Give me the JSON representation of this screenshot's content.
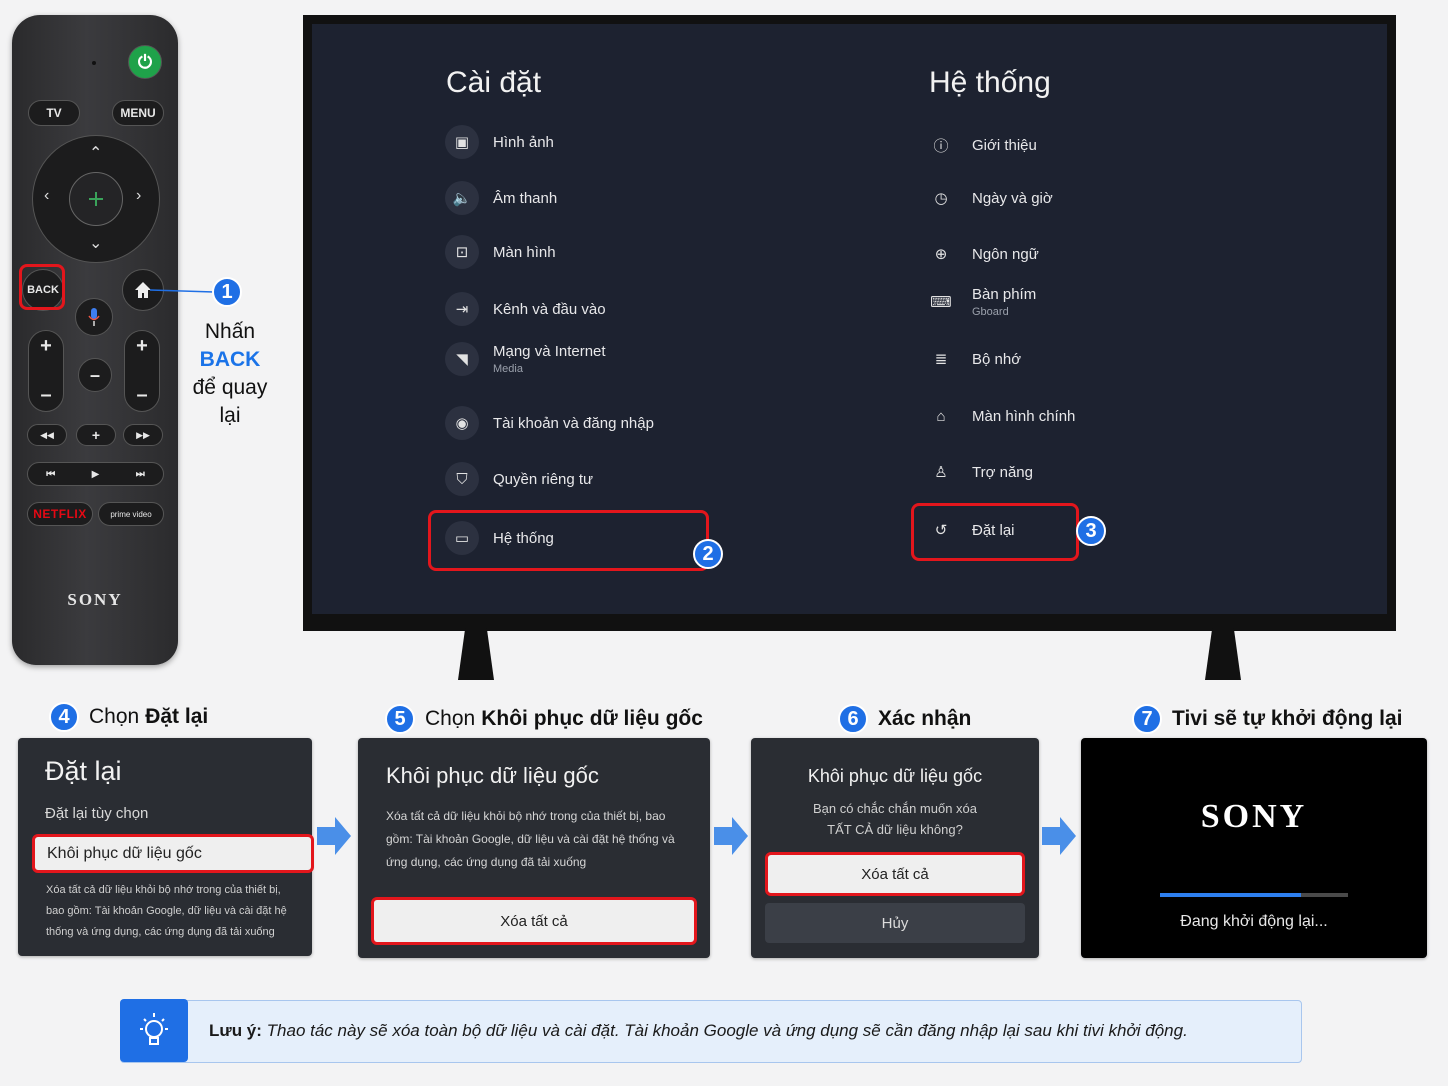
{
  "remote": {
    "tv_label": "TV",
    "menu_label": "MENU",
    "back_label": "BACK",
    "netflix_label": "NETFLIX",
    "prime_label": "prime video",
    "brand": "SONY"
  },
  "step1": {
    "number": "1",
    "line1": "Nhấn",
    "line2": "BACK",
    "line3": "để quay lại"
  },
  "tv": {
    "left_title": "Cài đặt",
    "right_title": "Hệ thống",
    "left_items": [
      {
        "label": "Hình ảnh",
        "icon": "image-icon"
      },
      {
        "label": "Âm thanh",
        "icon": "speaker-icon"
      },
      {
        "label": "Màn hình",
        "icon": "screen-icon"
      },
      {
        "label": "Kênh và đầu vào",
        "icon": "input-icon"
      },
      {
        "label": "Mạng và Internet",
        "sub": "Media",
        "icon": "wifi-icon"
      },
      {
        "label": "Tài khoản và đăng nhập",
        "icon": "account-icon"
      },
      {
        "label": "Quyền riêng tư",
        "icon": "shield-icon"
      },
      {
        "label": "Hệ thống",
        "icon": "monitor-icon"
      }
    ],
    "right_items": [
      {
        "label": "Giới thiệu",
        "icon": "info-icon"
      },
      {
        "label": "Ngày và giờ",
        "icon": "clock-icon"
      },
      {
        "label": "Ngôn ngữ",
        "icon": "globe-icon"
      },
      {
        "label": "Bàn phím",
        "sub": "Gboard",
        "icon": "keyboard-icon"
      },
      {
        "label": "Bộ nhớ",
        "icon": "storage-icon"
      },
      {
        "label": "Màn hình chính",
        "icon": "home-icon"
      },
      {
        "label": "Trợ năng",
        "icon": "accessibility-icon"
      },
      {
        "label": "Đặt lại",
        "icon": "reset-icon"
      }
    ],
    "badge2": "2",
    "badge3": "3"
  },
  "steps": {
    "s4": {
      "num": "4",
      "prefix": "Chọn",
      "bold": "Đặt lại"
    },
    "s5": {
      "num": "5",
      "prefix": "Chọn",
      "bold": "Khôi phục dữ liệu gốc"
    },
    "s6": {
      "num": "6",
      "bold": "Xác nhận"
    },
    "s7": {
      "num": "7",
      "bold": "Tivi sẽ tự khởi động lại"
    }
  },
  "panel4": {
    "title": "Đặt lại",
    "subtitle": "Đặt lại tùy chọn",
    "option": "Khôi phục dữ liệu gốc",
    "desc": "Xóa tất cả dữ liệu khỏi bộ nhớ trong của thiết bị, bao gồm: Tài khoản Google, dữ liệu và cài đặt hệ thống và ứng dụng, các ứng dụng đã tải xuống"
  },
  "panel5": {
    "title": "Khôi phục dữ liệu gốc",
    "desc": "Xóa tất cả dữ liệu khỏi bộ nhớ trong của thiết bị, bao gồm: Tài khoản Google, dữ liệu và cài đặt hệ thống và ứng dụng, các ứng dụng đã tải xuống",
    "button": "Xóa tất cả"
  },
  "panel6": {
    "title": "Khôi phục dữ liệu gốc",
    "question": "Bạn có chắc chắn muốn xóa TẤT CẢ dữ liệu không?",
    "confirm": "Xóa tất cả",
    "cancel": "Hủy"
  },
  "panel7": {
    "brand": "SONY",
    "status": "Đang khởi động lại...",
    "progress": 0.75
  },
  "note": {
    "label": "Lưu ý:",
    "text": "Thao tác này sẽ xóa toàn bộ dữ liệu và cài đặt. Tài khoản Google và ứng dụng sẽ cần đăng nhập lại sau khi tivi khởi động."
  },
  "colors": {
    "accent_blue": "#1f6fe5",
    "highlight_red": "#e3161c",
    "tv_bg": "#1d2230"
  }
}
